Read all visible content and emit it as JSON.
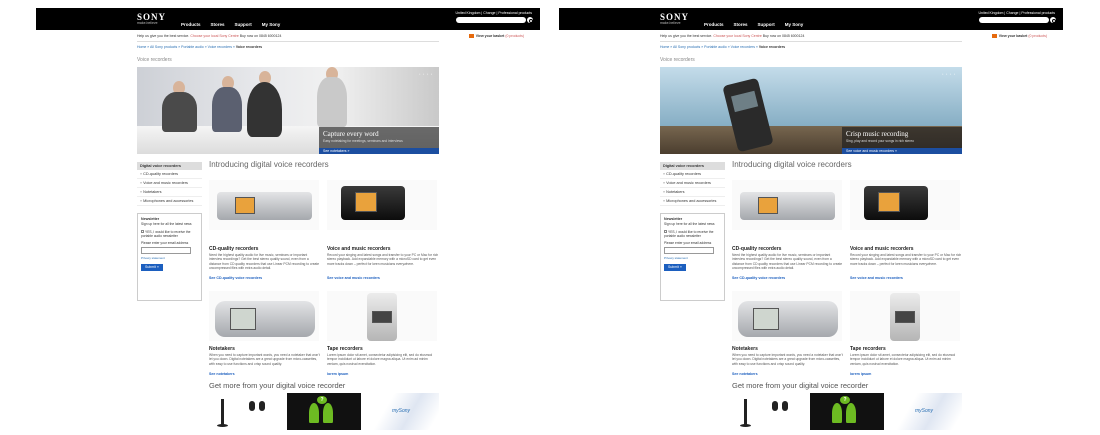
{
  "header": {
    "logo": "SONY",
    "tagline": "make.believe",
    "nav": [
      "Products",
      "Stores",
      "Support",
      "My Sony"
    ],
    "country": "United Kingdom | Change | Professional products"
  },
  "subheader": {
    "help_text": "Help us give you the best service.",
    "store_link": "Choose your local Sony Centre",
    "phone": "Buy now on 0845 6000124",
    "basket": "View your basket",
    "basket_count": "(0 products)"
  },
  "breadcrumb": {
    "trail": "Home » All Sony products » Portable audio » Voice recorders »",
    "current": "Voice recorders"
  },
  "page_title": "Voice recorders",
  "heroes": {
    "left": {
      "title": "Capture every word",
      "subtitle": "Easy notetaking for meetings, seminars and interviews",
      "link": "See notetakers  »",
      "dots": "• • • •"
    },
    "right": {
      "title": "Crisp music recording",
      "subtitle": "Sing, play and record your songs in rich stereo",
      "link": "See voice and music recorders  »",
      "dots": "• • • •"
    }
  },
  "sidebar": {
    "title": "Digital voice recorders",
    "items": [
      "CD-quality recorders",
      "Voice and music recorders",
      "Notetakers",
      "Microphones and accessories"
    ]
  },
  "newsletter": {
    "title": "Newsletter",
    "text": "Sign up here for all the latest news",
    "checkbox": "YES, I would like to receive the portable audio newsletter",
    "email_label": "Please enter your email address",
    "privacy": "Privacy statement",
    "submit": "Submit  »"
  },
  "intro": "Introducing digital voice recorders",
  "products": [
    {
      "title": "CD-quality recorders",
      "desc": "Need the highest quality audio for live music, seminars or important interview recordings? Get the best stereo quality sound, even from a distance from CD quality recorders that use Linear PCM recording to create uncompressed files with extra audio detail.",
      "link": "See CD-quality voice recorders"
    },
    {
      "title": "Voice and music recorders",
      "desc": "Record your singing and latest songs and transfer to your PC or Mac for rich stereo playback. Add expandable memory with a microSD card to get even more tracks down – perfect for keen musicians everywhere.",
      "link": "See voice and music recorders"
    },
    {
      "title": "Notetakers",
      "desc": "When you need to capture important words, you need a notetaker that won't let you down. Digital notetakers are a great upgrade from micro-cassettes, with easy to use functions and crisp sound quality.",
      "link": "See notetakers"
    },
    {
      "title": "Tape recorders",
      "desc": "Lorem ipsum dolor sit amet, consectetur adipisicing elit, sed do eiusmod tempor incididunt ut labore et dolore magna aliqua. Ut enim ad minim veniam, quis nostrud exercitation.",
      "link": "lorem ipsum"
    }
  ],
  "get_more": "Get more from your digital voice recorder",
  "tiles": {
    "badge": "?",
    "mysony": "mySony"
  },
  "colors": {
    "header_bg": "#000000",
    "link": "#1c5fbf",
    "caption_bar": "#1c4ea0",
    "basket_icon": "#e66a0d",
    "green": "#6dbb22"
  }
}
